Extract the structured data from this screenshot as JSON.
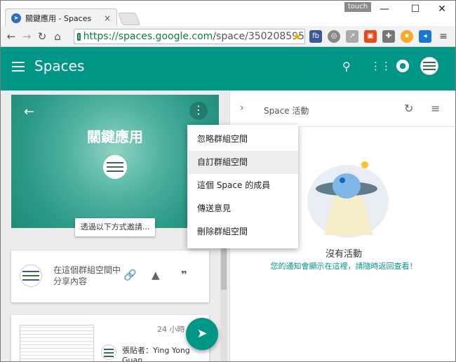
{
  "browser": {
    "tab_title": "關鍵應用 - Spaces",
    "tab_close": "×",
    "touch_label": "touch",
    "url_host": "https://spaces.google.com",
    "url_path": "/space/350208595",
    "window_controls": [
      "—",
      "☐",
      "✕"
    ]
  },
  "app": {
    "brand": "Spaces"
  },
  "space": {
    "name": "關鍵應用",
    "invite_label": "透過以下方式邀請..."
  },
  "share": {
    "prompt": "在這個群組空間中分享內容"
  },
  "post": {
    "time": "24 小時",
    "author": "張貼者：Ying Yong Guan"
  },
  "activity": {
    "header": "Space 活動",
    "empty_title": "沒有活動",
    "empty_subtitle": "您的通知會顯示在這裡，請隨時返回查看！"
  },
  "menu": {
    "items": [
      {
        "label": "忽略群組空間",
        "highlighted": false
      },
      {
        "label": "自訂群組空間",
        "highlighted": true
      },
      {
        "label": "這個 Space 的成員",
        "highlighted": false
      },
      {
        "label": "傳送意見",
        "highlighted": false
      },
      {
        "label": "刪除群組空間",
        "highlighted": false
      }
    ]
  },
  "colors": {
    "primary": "#009688",
    "url_green": "#0b8043"
  }
}
